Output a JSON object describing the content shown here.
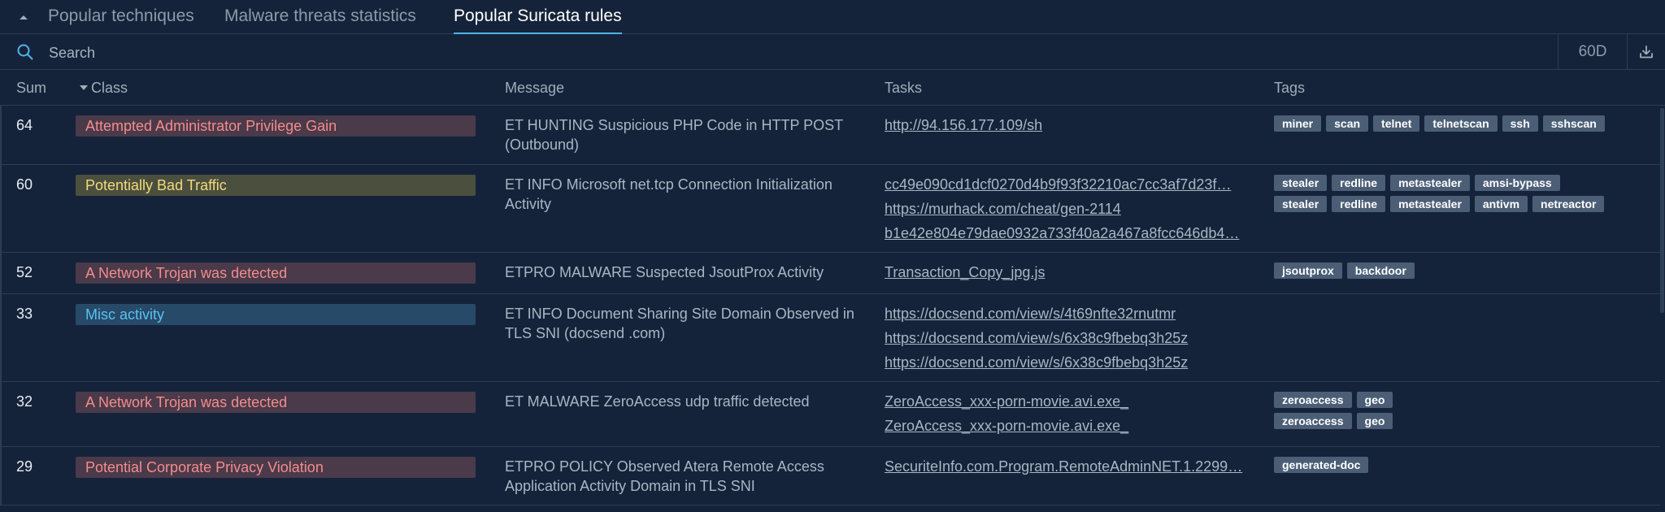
{
  "tabs": [
    {
      "label": "Popular techniques"
    },
    {
      "label": "Malware threats statistics"
    },
    {
      "label": "Popular Suricata rules"
    }
  ],
  "active_tab": "Popular Suricata rules",
  "search": {
    "placeholder": "Search",
    "value": ""
  },
  "period": "60D",
  "columns": {
    "sum": "Sum",
    "class": "Class",
    "message": "Message",
    "tasks": "Tasks",
    "tags": "Tags"
  },
  "sort": {
    "column": "Class",
    "direction": "descending"
  },
  "colors": {
    "accent": "#4fb3e8",
    "background": "#15233a",
    "red_badge_bg": "#4a3a4a",
    "red_badge_text": "#f48c8c",
    "yellow_badge_bg": "#4b4f3e",
    "yellow_badge_text": "#f2d97a",
    "blue_badge_bg": "#264a68",
    "blue_badge_text": "#5cc0ef",
    "tag_bg": "#4b5e76"
  },
  "icons": {
    "collapse": "chevron-up-icon",
    "search": "search-icon",
    "download": "download-icon"
  },
  "rows": [
    {
      "sum": "64",
      "class": "Attempted Administrator Privilege Gain",
      "class_color": "red",
      "message": "ET HUNTING Suspicious PHP Code in HTTP POST (Outbound)",
      "tasks": [
        "http://94.156.177.109/sh"
      ],
      "tags": [
        "miner",
        "scan",
        "telnet",
        "telnetscan",
        "ssh",
        "sshscan"
      ]
    },
    {
      "sum": "60",
      "class": "Potentially Bad Traffic",
      "class_color": "yellow",
      "message": "ET INFO Microsoft net.tcp Connection Initialization Activity",
      "tasks": [
        "cc49e090cd1dcf0270d4b9f93f32210ac7cc3af7d23f…",
        "https://murhack.com/cheat/gen-2114",
        "b1e42e804e79dae0932a733f40a2a467a8fcc646db4…"
      ],
      "tags": [
        "stealer",
        "redline",
        "metastealer",
        "amsi-bypass",
        "stealer",
        "redline",
        "metastealer",
        "antivm",
        "netreactor"
      ]
    },
    {
      "sum": "52",
      "class": "A Network Trojan was detected",
      "class_color": "red",
      "message": "ETPRO MALWARE Suspected JsoutProx Activity",
      "tasks": [
        "Transaction_Copy_jpg.js"
      ],
      "tags": [
        "jsoutprox",
        "backdoor"
      ]
    },
    {
      "sum": "33",
      "class": "Misc activity",
      "class_color": "blue",
      "message": "ET INFO Document Sharing Site Domain Observed in TLS SNI (docsend .com)",
      "tasks": [
        "https://docsend.com/view/s/4t69nfte32rnutmr",
        "https://docsend.com/view/s/6x38c9fbebq3h25z",
        "https://docsend.com/view/s/6x38c9fbebq3h25z"
      ],
      "tags": []
    },
    {
      "sum": "32",
      "class": "A Network Trojan was detected",
      "class_color": "red",
      "message": "ET MALWARE ZeroAccess udp traffic detected",
      "tasks": [
        "ZeroAccess_xxx-porn-movie.avi.exe_",
        "ZeroAccess_xxx-porn-movie.avi.exe_"
      ],
      "tags": [
        "zeroaccess",
        "geo",
        "zeroaccess",
        "geo"
      ]
    },
    {
      "sum": "29",
      "class": "Potential Corporate Privacy Violation",
      "class_color": "red",
      "message": "ETPRO POLICY Observed Atera Remote Access Application Activity Domain in TLS SNI",
      "tasks": [
        "SecuriteInfo.com.Program.RemoteAdminNET.1.2299…"
      ],
      "tags": [
        "generated-doc"
      ]
    }
  ]
}
